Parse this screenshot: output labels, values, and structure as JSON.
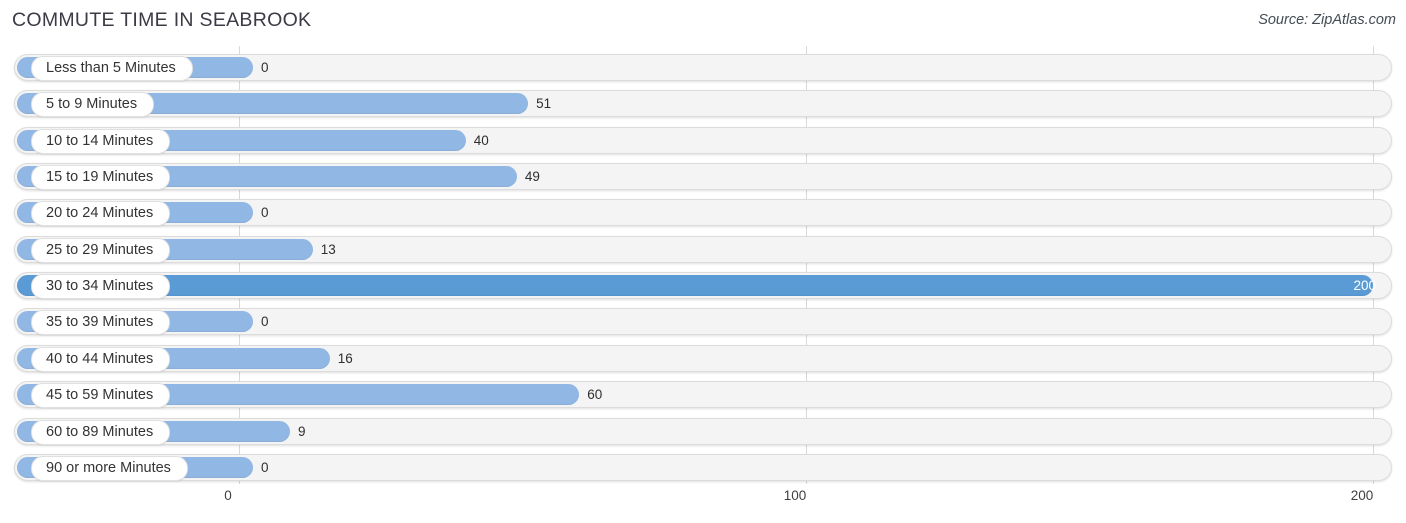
{
  "header": {
    "title": "COMMUTE TIME IN SEABROOK",
    "source": "Source: ZipAtlas.com"
  },
  "colors": {
    "bar": "#91b8e4",
    "bar_highlight": "#5b9bd5",
    "track": "#f4f4f4",
    "track_border": "#dcdcdc",
    "gridline": "#d9d9d9",
    "text": "#2f2f2f"
  },
  "chart_data": {
    "type": "bar",
    "orientation": "horizontal",
    "title": "COMMUTE TIME IN SEABROOK",
    "subtitle": "",
    "xlabel": "",
    "ylabel": "",
    "xlim": [
      0,
      200
    ],
    "xticks": [
      0,
      100,
      200
    ],
    "xtick_labels": [
      "0",
      "100",
      "200"
    ],
    "grid": true,
    "legend": null,
    "source": "Source: ZipAtlas.com",
    "highlight_category": "30 to 34 Minutes",
    "categories": [
      "Less than 5 Minutes",
      "5 to 9 Minutes",
      "10 to 14 Minutes",
      "15 to 19 Minutes",
      "20 to 24 Minutes",
      "25 to 29 Minutes",
      "30 to 34 Minutes",
      "35 to 39 Minutes",
      "40 to 44 Minutes",
      "45 to 59 Minutes",
      "60 to 89 Minutes",
      "90 or more Minutes"
    ],
    "values": [
      0,
      51,
      40,
      49,
      0,
      13,
      200,
      0,
      16,
      60,
      9,
      0
    ],
    "value_labels": [
      "0",
      "51",
      "40",
      "49",
      "0",
      "13",
      "200",
      "0",
      "16",
      "60",
      "9",
      "0"
    ]
  }
}
